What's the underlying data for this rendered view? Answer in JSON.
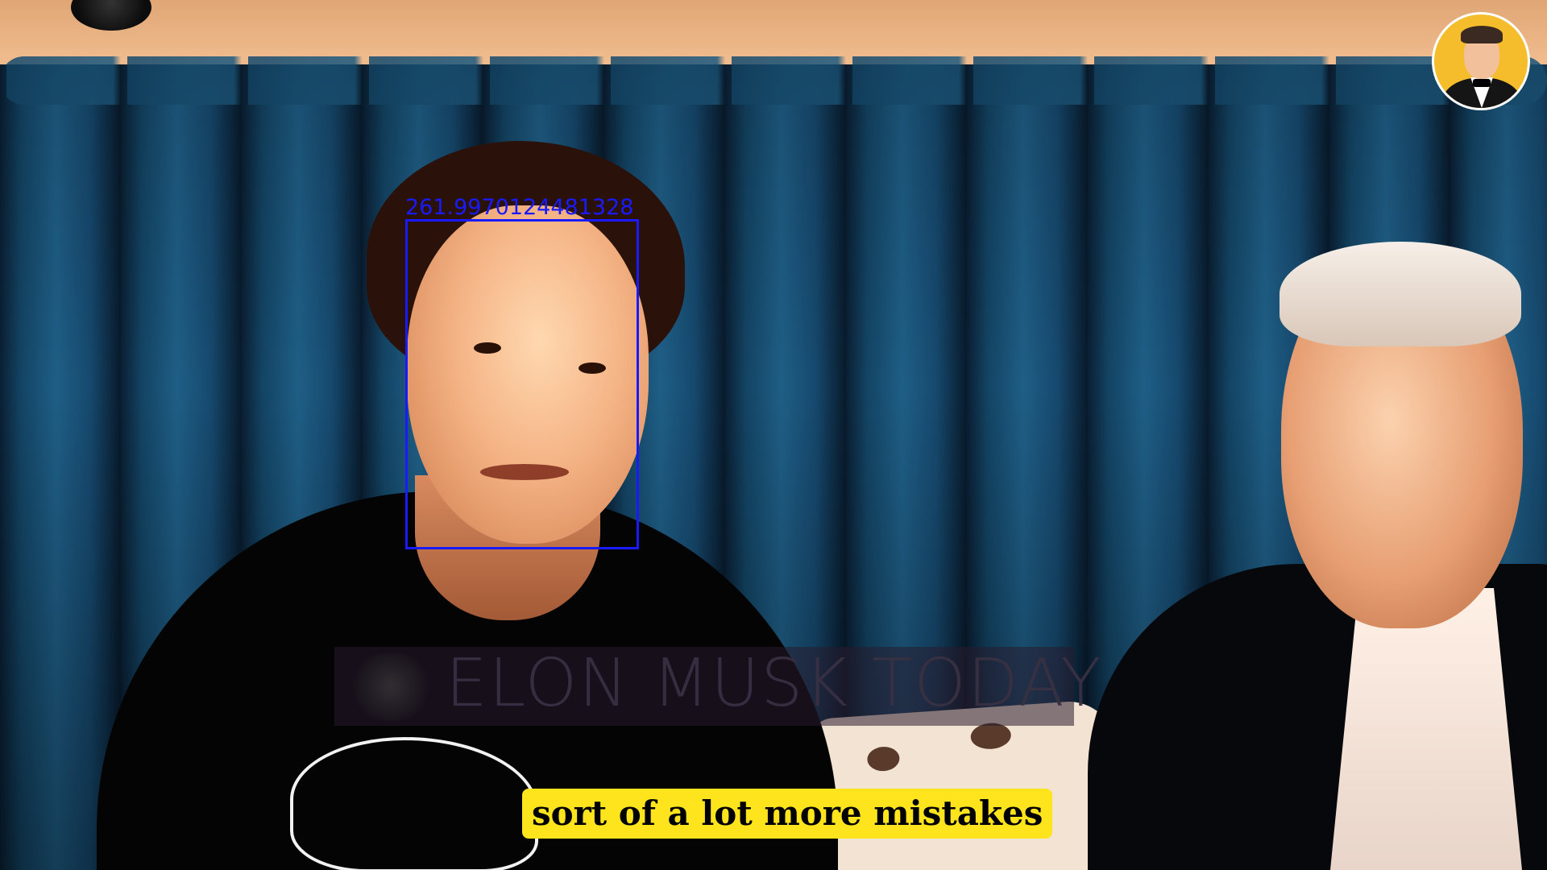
{
  "video": {
    "face_detection_label": "261.9970124481328",
    "watermark": "ELON MUSK TODAY",
    "subtitle": "sort of a lot more mistakes",
    "channel_avatar_icon": "elon-musk-portrait-icon"
  },
  "colors": {
    "detection_box": "#1a1aff",
    "subtitle_bg": "#fde41c",
    "backdrop": "#1f5e86",
    "avatar_bg": "#f5bd2b"
  }
}
